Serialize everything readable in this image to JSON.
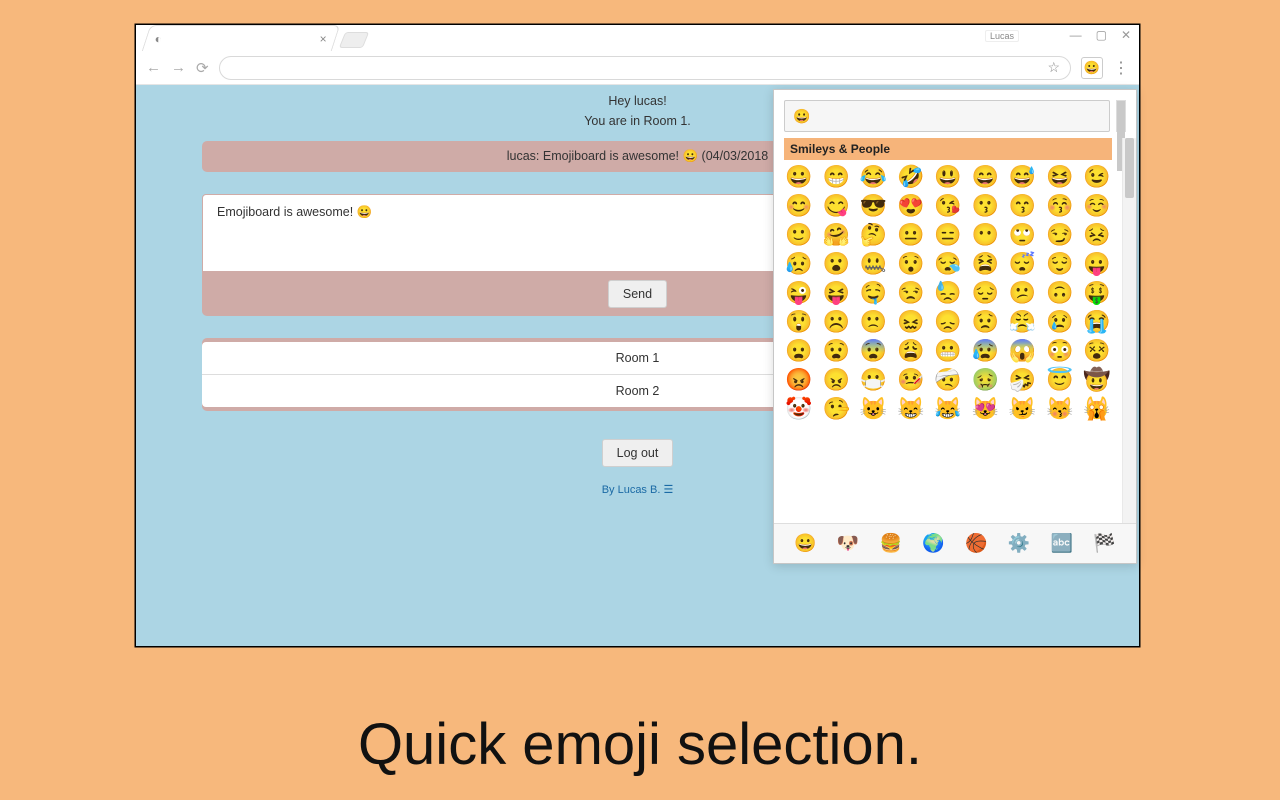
{
  "caption": "Quick emoji selection.",
  "browser": {
    "user": "Lucas",
    "tab_title": "",
    "ext_icon": "😀"
  },
  "page": {
    "greet1": "Hey lucas!",
    "greet2": "You are in Room 1.",
    "last_message": "lucas: Emojiboard is awesome! 😀 (04/03/2018",
    "compose_text": "Emojiboard is awesome! 😀",
    "send": "Send",
    "rooms": [
      "Room 1",
      "Room 2"
    ],
    "logout": "Log out",
    "byline": "By Lucas B. ☰"
  },
  "popup": {
    "search_value": "😀",
    "category_header": "Smileys & People",
    "emojis": [
      "😀",
      "😁",
      "😂",
      "🤣",
      "😃",
      "😄",
      "😅",
      "😆",
      "😉",
      "😊",
      "😋",
      "😎",
      "😍",
      "😘",
      "😗",
      "😙",
      "😚",
      "☺️",
      "🙂",
      "🤗",
      "🤔",
      "😐",
      "😑",
      "😶",
      "🙄",
      "😏",
      "😣",
      "😥",
      "😮",
      "🤐",
      "😯",
      "😪",
      "😫",
      "😴",
      "😌",
      "😛",
      "😜",
      "😝",
      "🤤",
      "😒",
      "😓",
      "😔",
      "😕",
      "🙃",
      "🤑",
      "😲",
      "☹️",
      "🙁",
      "😖",
      "😞",
      "😟",
      "😤",
      "😢",
      "😭",
      "😦",
      "😧",
      "😨",
      "😩",
      "😬",
      "😰",
      "😱",
      "😳",
      "😵",
      "😡",
      "😠",
      "😷",
      "🤒",
      "🤕",
      "🤢",
      "🤧",
      "😇",
      "🤠",
      "🤡",
      "🤥",
      "😺",
      "😸",
      "😹",
      "😻",
      "😼",
      "😽",
      "🙀"
    ],
    "categories": [
      "😀",
      "🐶",
      "🍔",
      "🌍",
      "🏀",
      "⚙️",
      "🔤",
      "🏁"
    ]
  }
}
